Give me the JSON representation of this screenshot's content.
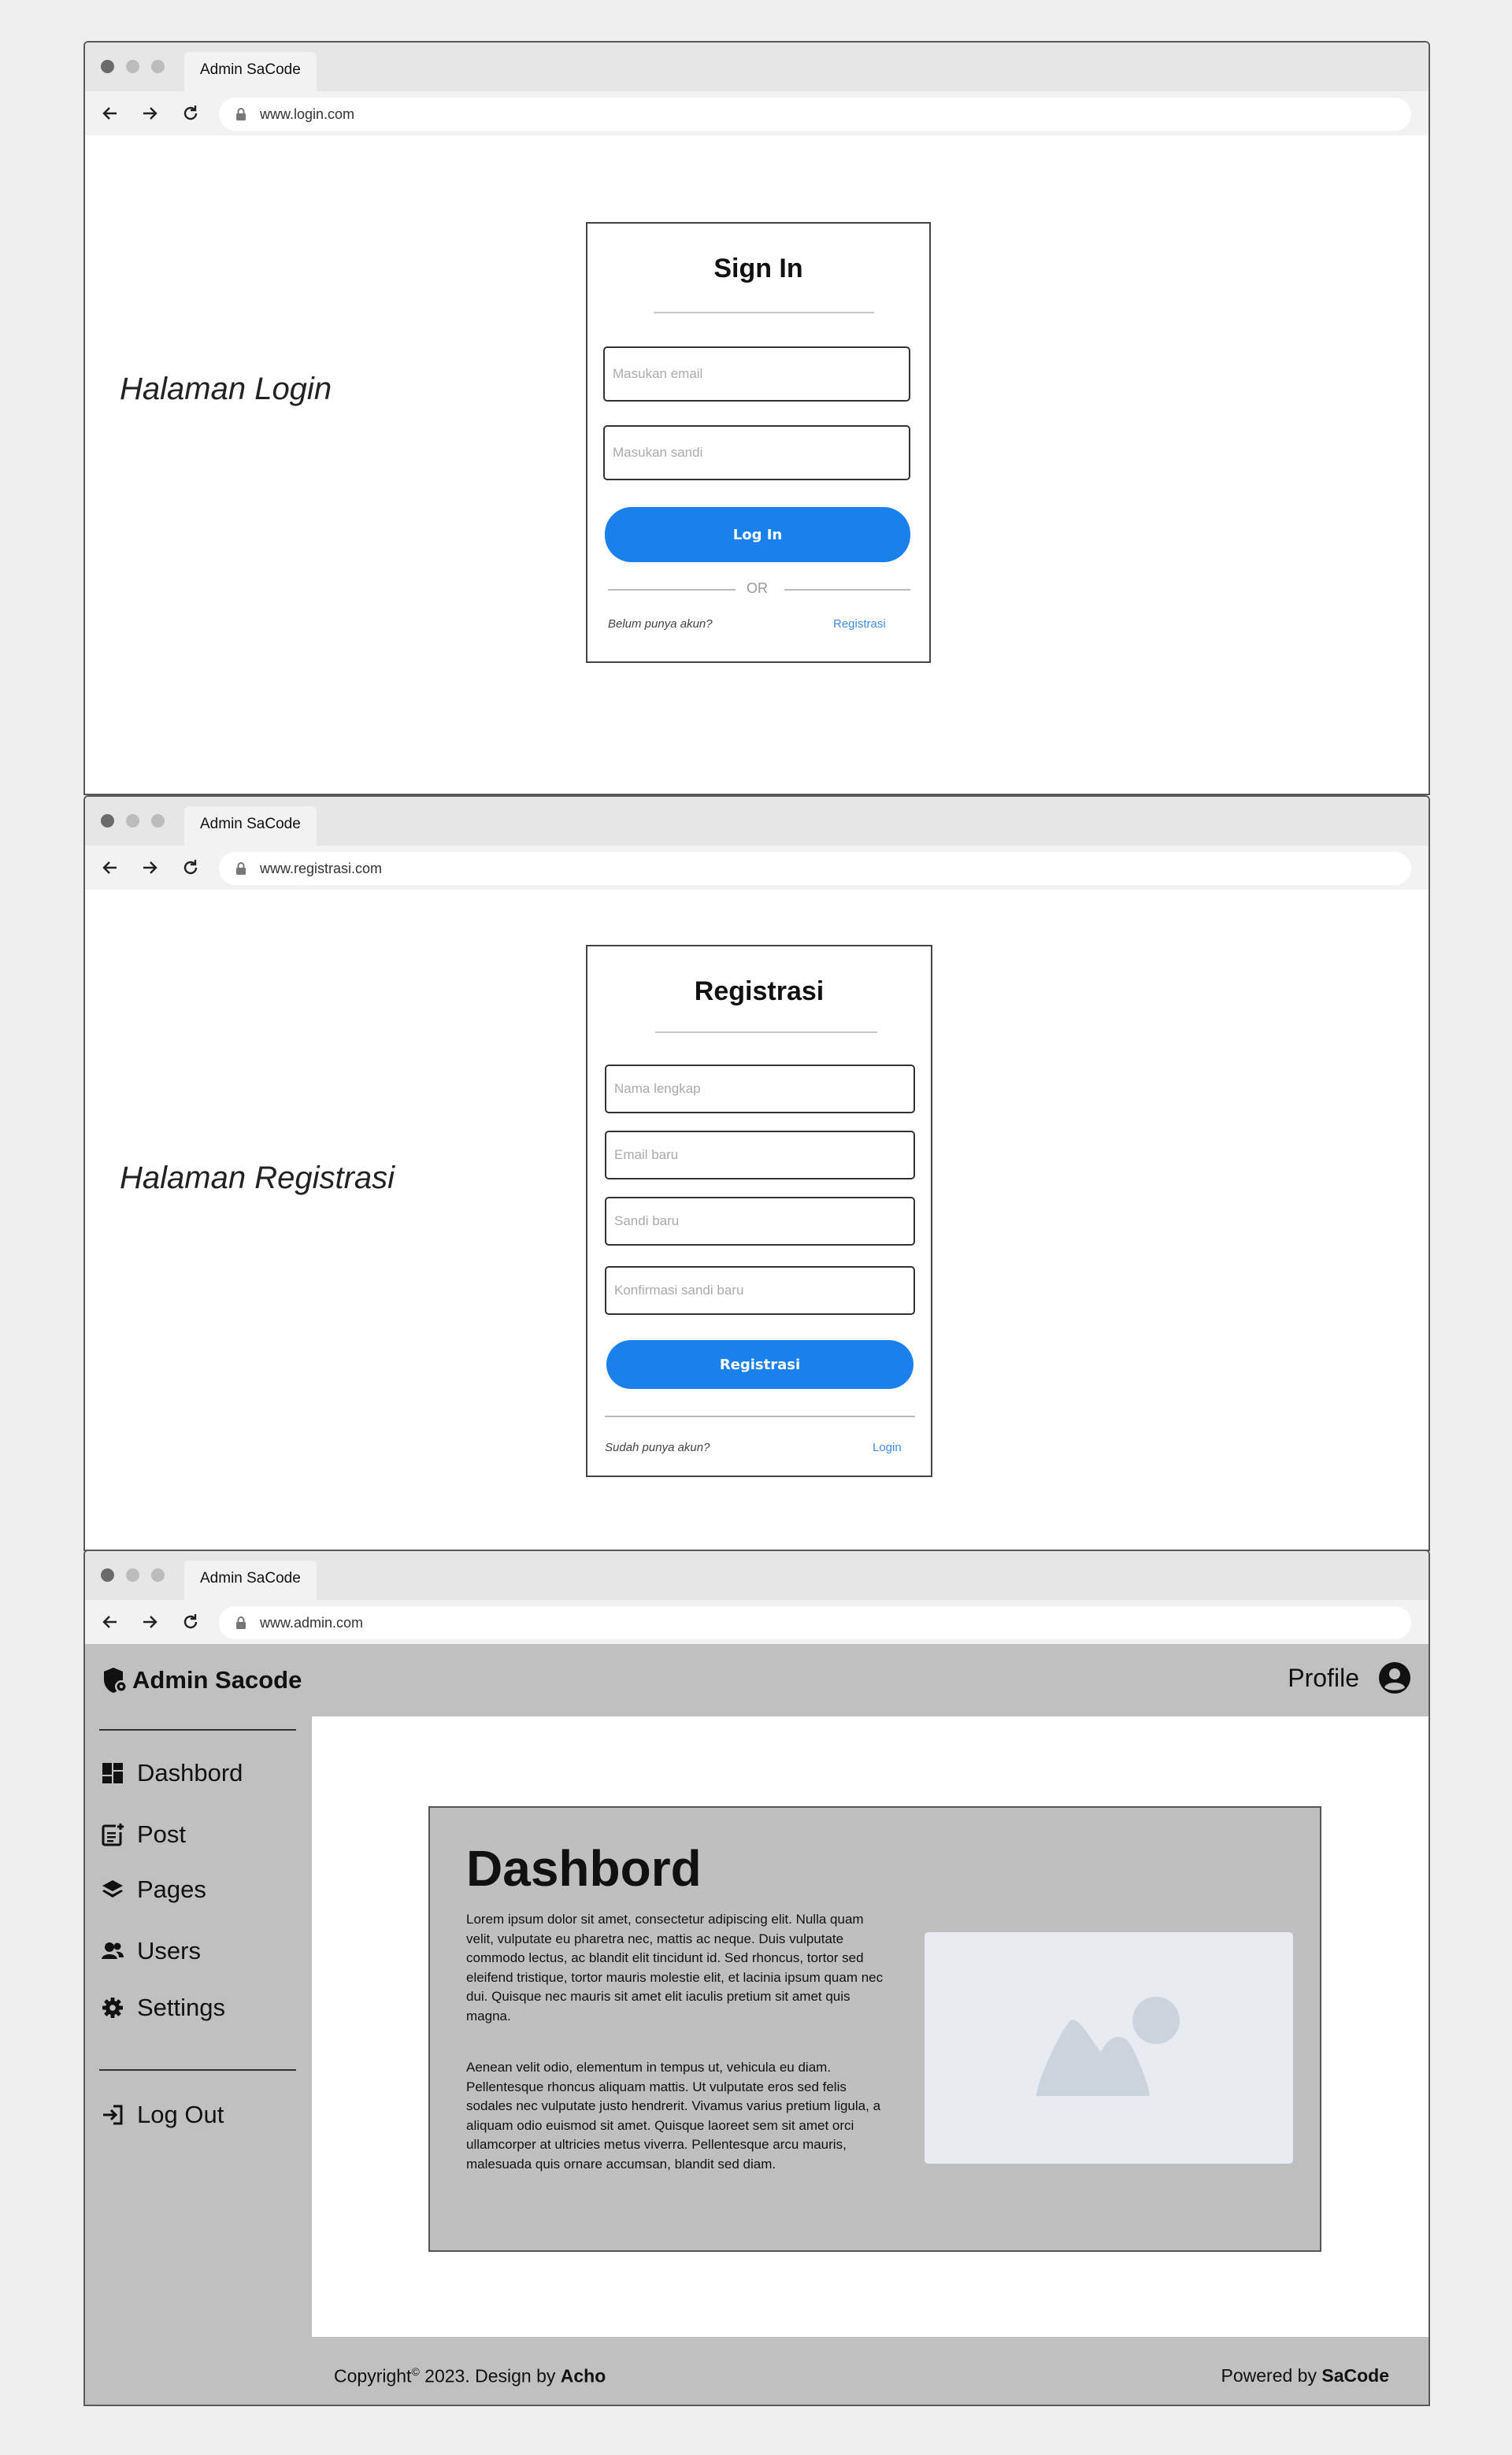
{
  "windows": [
    {
      "tab_title": "Admin SaCode",
      "url": "www.login.com",
      "page_label": "Halaman Login",
      "card": {
        "title": "Sign In",
        "email_placeholder": "Masukan email",
        "password_placeholder": "Masukan sandi",
        "button_label": "Log In",
        "or_text": "OR",
        "prompt_text": "Belum punya akun?",
        "link_text": "Registrasi"
      }
    },
    {
      "tab_title": "Admin SaCode",
      "url": "www.registrasi.com",
      "page_label": "Halaman Registrasi",
      "card": {
        "title": "Registrasi",
        "name_placeholder": "Nama lengkap",
        "email_placeholder": "Email baru",
        "password_placeholder": "Sandi baru",
        "confirm_placeholder": "Konfirmasi sandi baru",
        "button_label": "Registrasi",
        "prompt_text": "Sudah punya akun?",
        "link_text": "Login"
      }
    },
    {
      "tab_title": "Admin SaCode",
      "url": "www.admin.com",
      "brand": "Admin Sacode",
      "profile_label": "Profile",
      "sidebar": {
        "items": [
          {
            "label": "Dashbord",
            "icon": "dashboard-icon"
          },
          {
            "label": "Post",
            "icon": "post-icon"
          },
          {
            "label": "Pages",
            "icon": "layers-icon"
          },
          {
            "label": "Users",
            "icon": "users-icon"
          },
          {
            "label": "Settings",
            "icon": "gear-icon"
          }
        ],
        "logout_label": "Log Out"
      },
      "content": {
        "title": "Dashbord",
        "paragraph1": "Lorem ipsum dolor sit amet, consectetur adipiscing elit. Nulla quam velit, vulputate eu pharetra nec, mattis ac neque. Duis vulputate commodo lectus, ac blandit elit tincidunt id. Sed rhoncus, tortor sed eleifend tristique, tortor mauris molestie elit, et lacinia ipsum quam nec dui. Quisque nec mauris sit amet elit iaculis pretium sit amet quis magna.",
        "paragraph2": "Aenean velit odio, elementum in tempus ut, vehicula eu diam. Pellentesque rhoncus aliquam mattis. Ut vulputate eros sed felis sodales nec vulputate justo hendrerit. Vivamus varius pretium ligula, a aliquam odio euismod sit amet. Quisque laoreet sem sit amet orci ullamcorper at ultricies metus viverra. Pellentesque arcu mauris, malesuada quis ornare accumsan, blandit sed diam."
      },
      "footer": {
        "copyright_prefix": "Copyright",
        "copyright_symbol": "©",
        "copyright_middle": " 2023. Design by ",
        "designer": "Acho",
        "powered_prefix": "Powered by ",
        "powered_brand": "SaCode"
      }
    }
  ],
  "colors": {
    "primary_button": "#1a80ec",
    "link": "#3f8ce8",
    "admin_panel_gray": "#c0c0c0",
    "chrome_bar": "#e6e6e6"
  }
}
